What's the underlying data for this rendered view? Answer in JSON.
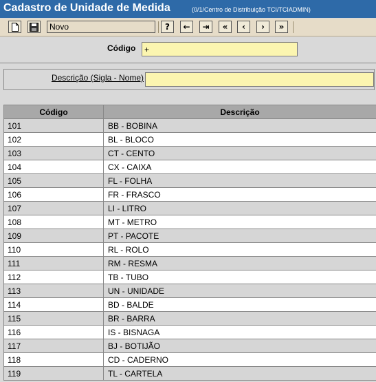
{
  "window": {
    "title": "Cadastro de Unidade de Medida",
    "subtitle": "(0/1/Centro de Distribuição TCI/TCIADMIN)"
  },
  "toolbar": {
    "status_value": "Novo",
    "help_label": "?",
    "back_label": "←",
    "exit_label": "⇥",
    "first_label": "«",
    "prev_label": "‹",
    "next_label": "›",
    "last_label": "»"
  },
  "form": {
    "codigo_label": "Código",
    "codigo_value": "+",
    "descricao_label": "Descrição (Sigla - Nome)",
    "descricao_value": ""
  },
  "table": {
    "headers": [
      "Código",
      "Descrição"
    ],
    "rows": [
      {
        "codigo": "101",
        "descricao": "BB - BOBINA"
      },
      {
        "codigo": "102",
        "descricao": "BL - BLOCO"
      },
      {
        "codigo": "103",
        "descricao": "CT - CENTO"
      },
      {
        "codigo": "104",
        "descricao": "CX - CAIXA"
      },
      {
        "codigo": "105",
        "descricao": "FL - FOLHA"
      },
      {
        "codigo": "106",
        "descricao": "FR - FRASCO"
      },
      {
        "codigo": "107",
        "descricao": "LI - LITRO"
      },
      {
        "codigo": "108",
        "descricao": "MT - METRO"
      },
      {
        "codigo": "109",
        "descricao": "PT - PACOTE"
      },
      {
        "codigo": "110",
        "descricao": "RL - ROLO"
      },
      {
        "codigo": "111",
        "descricao": "RM - RESMA"
      },
      {
        "codigo": "112",
        "descricao": "TB - TUBO"
      },
      {
        "codigo": "113",
        "descricao": "UN - UNIDADE"
      },
      {
        "codigo": "114",
        "descricao": "BD - BALDE"
      },
      {
        "codigo": "115",
        "descricao": "BR - BARRA"
      },
      {
        "codigo": "116",
        "descricao": "IS - BISNAGA"
      },
      {
        "codigo": "117",
        "descricao": "BJ - BOTIJÃO"
      },
      {
        "codigo": "118",
        "descricao": "CD - CADERNO"
      },
      {
        "codigo": "119",
        "descricao": "TL - CARTELA"
      }
    ]
  },
  "colors": {
    "titlebar": "#2e6aa8",
    "toolbar": "#e6dcc8",
    "input": "#fbf5b0",
    "header": "#a8a8a8"
  },
  "icons": [
    "new-document-icon",
    "save-icon"
  ]
}
